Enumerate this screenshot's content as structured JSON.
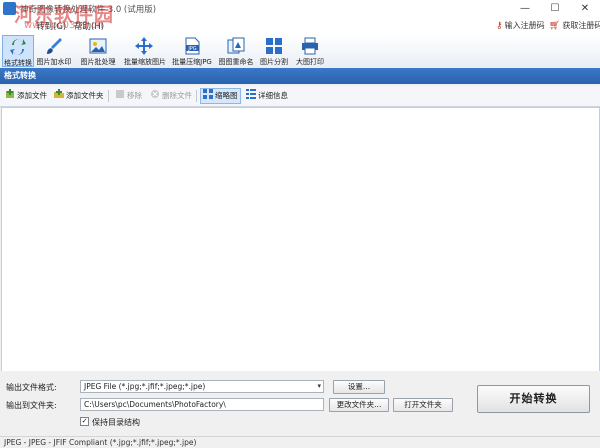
{
  "window": {
    "title": "神奇图像转换处理软件 3.0 (试用版)",
    "minimize": "—",
    "maximize": "☐",
    "close": "✕"
  },
  "watermark": {
    "text": "河东软件园",
    "url": "www.pc0359.cn"
  },
  "menu": {
    "items": [
      "转到(G)",
      "帮助(H)"
    ],
    "register_code": "输入注册码",
    "get_register_code": "获取注册码"
  },
  "toolbar": {
    "tools": [
      {
        "label": "格式转换",
        "icon": "format-convert-icon",
        "active": true
      },
      {
        "label": "图片加水印",
        "icon": "brush-icon"
      },
      {
        "label": "图片批处理",
        "icon": "image-icon"
      },
      {
        "label": "批量缩放图片",
        "icon": "move-arrows-icon"
      },
      {
        "label": "批量压缩JPG",
        "icon": "jpg-icon"
      },
      {
        "label": "图图重命名",
        "icon": "rename-icon"
      },
      {
        "label": "图片分割",
        "icon": "grid-icon"
      },
      {
        "label": "大图打印",
        "icon": "printer-icon"
      }
    ]
  },
  "section": {
    "title": "格式转换"
  },
  "subtoolbar": {
    "add_file": "添加文件",
    "add_folder": "添加文件夹",
    "remove": "移除",
    "delete_file": "删除文件",
    "thumbnail": "缩略图",
    "details": "详细信息"
  },
  "settings": {
    "output_format_label": "输出文件格式:",
    "output_format_value": "JPEG File (*.jpg;*.jfif;*.jpeg;*.jpe)",
    "settings_button": "设置...",
    "output_folder_label": "输出到文件夹:",
    "output_folder_value": "C:\\Users\\pc\\Documents\\PhotoFactory\\",
    "change_folder_button": "更改文件夹...",
    "open_folder_button": "打开文件夹",
    "keep_structure_label": "保持目录结构",
    "keep_structure_checked": true,
    "start_button": "开始转换"
  },
  "status": {
    "text": "JPEG - JPEG - JFIF Compliant (*.jpg;*.jfif;*.jpeg;*.jpe)"
  },
  "colors": {
    "accent": "#2a62ad",
    "watermark": "#d22828"
  }
}
